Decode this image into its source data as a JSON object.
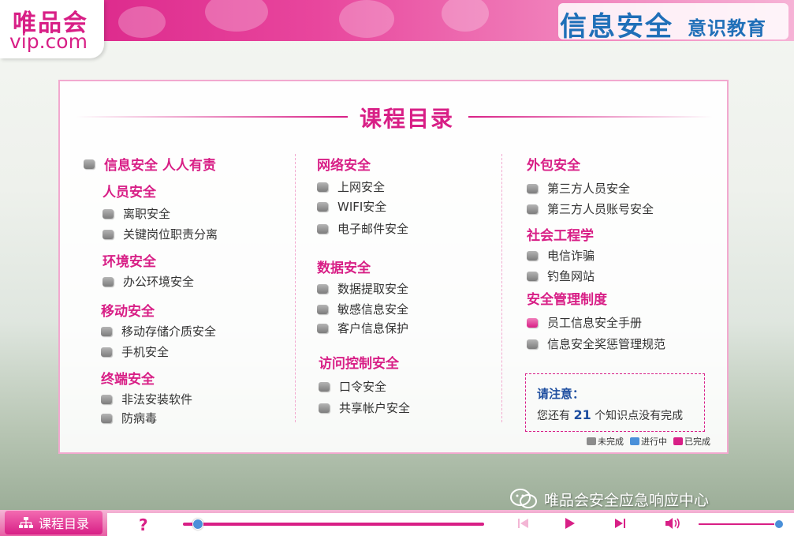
{
  "header": {
    "logo_cn": "唯品会",
    "logo_en": "vip.com",
    "brand_main": "信息安全",
    "brand_sub": "意识教育"
  },
  "panel": {
    "title": "课程目录",
    "col1": {
      "top": {
        "label": "信息安全 人人有责",
        "status": "pending"
      },
      "sections": [
        {
          "title": "人员安全",
          "items": [
            {
              "label": "离职安全",
              "status": "pending"
            },
            {
              "label": "关键岗位职责分离",
              "status": "pending"
            }
          ]
        },
        {
          "title": "环境安全",
          "items": [
            {
              "label": "办公环境安全",
              "status": "pending"
            }
          ]
        },
        {
          "title": "移动安全",
          "items": [
            {
              "label": "移动存储介质安全",
              "status": "pending"
            },
            {
              "label": "手机安全",
              "status": "pending"
            }
          ]
        },
        {
          "title": "终端安全",
          "items": [
            {
              "label": "非法安装软件",
              "status": "pending"
            },
            {
              "label": "防病毒",
              "status": "pending"
            }
          ]
        }
      ]
    },
    "col2": {
      "sections": [
        {
          "title": "网络安全",
          "items": [
            {
              "label": "上网安全",
              "status": "pending"
            },
            {
              "label": "WIFI安全",
              "status": "pending"
            },
            {
              "label": "电子邮件安全",
              "status": "pending"
            }
          ]
        },
        {
          "title": "数据安全",
          "items": [
            {
              "label": "数据提取安全",
              "status": "pending"
            },
            {
              "label": "敏感信息安全",
              "status": "pending"
            },
            {
              "label": "客户信息保护",
              "status": "pending"
            }
          ]
        },
        {
          "title": "访问控制安全",
          "items": [
            {
              "label": "口令安全",
              "status": "pending"
            },
            {
              "label": "共享帐户安全",
              "status": "pending"
            }
          ]
        }
      ]
    },
    "col3": {
      "sections": [
        {
          "title": "外包安全",
          "items": [
            {
              "label": "第三方人员安全",
              "status": "pending"
            },
            {
              "label": "第三方人员账号安全",
              "status": "pending"
            }
          ]
        },
        {
          "title": "社会工程学",
          "items": [
            {
              "label": "电信诈骗",
              "status": "pending"
            },
            {
              "label": "钓鱼网站",
              "status": "pending"
            }
          ]
        },
        {
          "title": "安全管理制度",
          "items": [
            {
              "label": "员工信息安全手册",
              "status": "done"
            },
            {
              "label": "信息安全奖惩管理规范",
              "status": "pending"
            }
          ]
        }
      ]
    },
    "notice": {
      "title": "请注意：",
      "text_before": "您还有",
      "count": "21",
      "text_after": "个知识点没有完成"
    },
    "legend": {
      "pending": "未完成",
      "in_progress": "进行中",
      "done": "已完成"
    }
  },
  "watermark": "唯品会安全应急响应中心",
  "footer": {
    "toc_button": "课程目录",
    "help": "?"
  },
  "colors": {
    "brand_pink": "#d81f86",
    "title_blue": "#1f6fb8",
    "pending": "#8c8c8c",
    "in_progress": "#4a90d9",
    "done": "#d81f86"
  }
}
